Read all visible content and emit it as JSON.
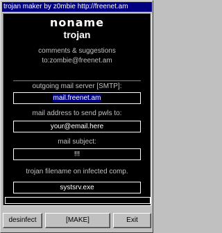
{
  "window": {
    "title": "trojan maker by z0mbie http://freenet.am"
  },
  "header": {
    "logo": "noname",
    "subtitle": "trojan",
    "info_line1": "comments & suggestions",
    "info_line2": "to:zombie@freenet.am"
  },
  "fields": {
    "smtp_label": "outgoing mail server [SMTP]:",
    "smtp_value": "mail.freenet.am",
    "email_label": "mail address to send pwls to:",
    "email_value": "your@email.here",
    "subject_label": "mail subject:",
    "subject_value": "!!!",
    "filename_label": "trojan filename on infected comp.",
    "filename_value": "systsrv.exe"
  },
  "buttons": {
    "desinfect": "desinfect",
    "make": "[MAKE]",
    "exit": "Exit"
  }
}
